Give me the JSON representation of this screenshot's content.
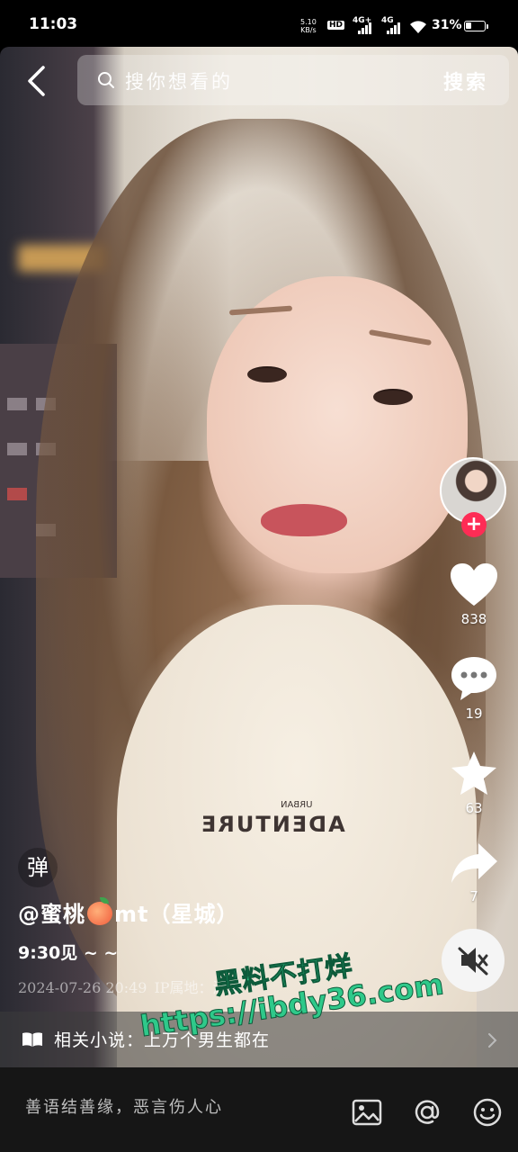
{
  "status_bar": {
    "time": "11:03",
    "net_speed_value": "5.10",
    "net_speed_unit": "KB/s",
    "hd_label": "HD",
    "sim1_label": "4G+",
    "sim2_label": "4G",
    "battery_pct": "31%"
  },
  "search": {
    "placeholder": "搜你想看的",
    "button_label": "搜索"
  },
  "video": {
    "shirt_brand": "ADEΝTURE",
    "shirt_small": "URBAN"
  },
  "actions": {
    "likes": "838",
    "comments": "19",
    "favorites": "63",
    "shares": "7"
  },
  "post": {
    "danmu_label": "弹",
    "author_prefix": "@蜜桃",
    "author_suffix": "mt（星城）",
    "description": "9:30见 ~ ~",
    "date": "2024-07-26 20:49",
    "ip_location": "IP属地：湖南"
  },
  "related": {
    "label": "相关小说：上万个男生都在"
  },
  "watermark": {
    "line1": "黑料不打烊",
    "line2": "https://ibdy36.com"
  },
  "comment_bar": {
    "placeholder": "善语结善缘，恶言伤人心"
  },
  "colors": {
    "follow_red": "#fe2c55",
    "watermark_green": "#2fc98a"
  }
}
